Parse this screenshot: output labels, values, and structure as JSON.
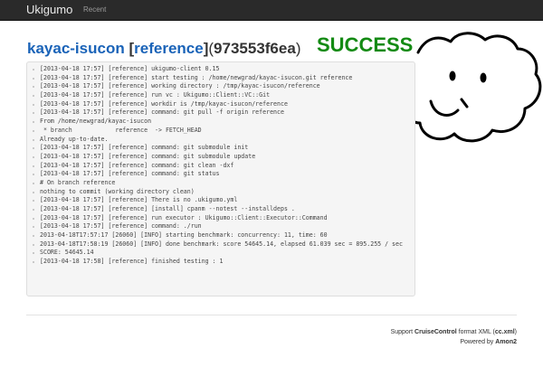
{
  "navbar": {
    "brand": "Ukigumo",
    "recent_link": "Recent"
  },
  "header": {
    "project": "kayac-isucon",
    "branch_open": "[",
    "branch": "reference",
    "branch_close": "]",
    "commit_open": "(",
    "commit": "973553f6ea",
    "commit_close": ")",
    "status": "SUCCESS",
    "status_color": "#138a13"
  },
  "log": {
    "lines": [
      "[2013-04-18 17:57] [reference] ukigumo-client 0.15",
      "[2013-04-18 17:57] [reference] start testing : /home/newgrad/kayac-isucon.git reference",
      "[2013-04-18 17:57] [reference] working directory : /tmp/kayac-isucon/reference",
      "[2013-04-18 17:57] [reference] run vc : Ukigumo::Client::VC::Git",
      "[2013-04-18 17:57] [reference] workdir is /tmp/kayac-isucon/reference",
      "[2013-04-18 17:57] [reference] command: git pull -f origin reference",
      "From /home/newgrad/kayac-isucon",
      " * branch            reference  -> FETCH_HEAD",
      "Already up-to-date.",
      "[2013-04-18 17:57] [reference] command: git submodule init",
      "[2013-04-18 17:57] [reference] command: git submodule update",
      "[2013-04-18 17:57] [reference] command: git clean -dxf",
      "[2013-04-18 17:57] [reference] command: git status",
      "# On branch reference",
      "nothing to commit (working directory clean)",
      "[2013-04-18 17:57] [reference] There is no .ukigumo.yml",
      "[2013-04-18 17:57] [reference] [install] cpanm --notest --installdeps .",
      "[2013-04-18 17:57] [reference] run executor : Ukigumo::Client::Executor::Command",
      "[2013-04-18 17:57] [reference] command: ./run",
      "2013-04-18T17:57:17 [26060] [INFO] starting benchmark: concurrency: 11, time: 60",
      "2013-04-18T17:58:19 [26060] [INFO] done benchmark: score 54645.14, elapsed 61.039 sec = 895.255 / sec",
      "SCORE: 54645.14",
      "[2013-04-18 17:58] [reference] finished testing : 1"
    ]
  },
  "footer": {
    "support_prefix": "Support ",
    "cruisecontrol": "CruiseControl",
    "format_text": " format XML (",
    "cc_xml": "cc.xml",
    "close_paren": ")",
    "powered_prefix": "Powered by ",
    "amon2": "Amon2"
  }
}
